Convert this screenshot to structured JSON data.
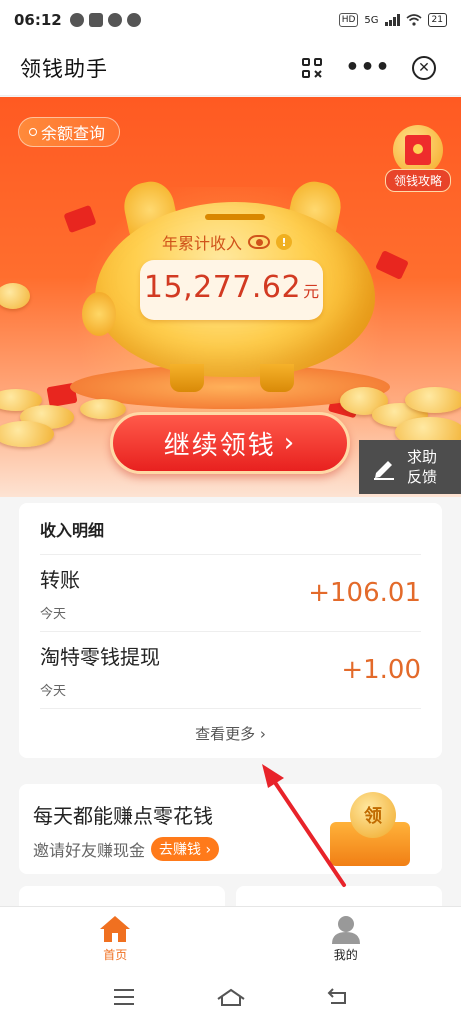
{
  "status_bar": {
    "time": "06:12",
    "hd_label": "HD",
    "network_label": "5G",
    "battery": "21"
  },
  "title_bar": {
    "title": "领钱助手"
  },
  "hero": {
    "balance_query_label": "余额查询",
    "strategy_label": "领钱攻略",
    "year_income_label": "年累计收入",
    "year_income_amount": "15,277.62",
    "currency_unit": "元",
    "continue_button": "继续领钱",
    "continue_chevron": "›"
  },
  "help": {
    "label_line1": "求助",
    "label_line2": "反馈"
  },
  "income": {
    "title": "收入明细",
    "rows": [
      {
        "name": "转账",
        "date": "今天",
        "amount": "+106.01"
      },
      {
        "name": "淘特零钱提现",
        "date": "今天",
        "amount": "+1.00"
      }
    ],
    "more_link": "查看更多",
    "more_chevron": "›"
  },
  "earn": {
    "headline": "每天都能赚点零花钱",
    "sub_text": "邀请好友赚现金",
    "go_button": "去赚钱",
    "go_chevron": "›",
    "coin_char": "领"
  },
  "tabs": [
    {
      "label": "首页",
      "icon": "home-icon",
      "active": true
    },
    {
      "label": "我的",
      "icon": "profile-icon",
      "active": false
    }
  ],
  "colors": {
    "accent": "#f07020",
    "hero_red": "#ff5a22",
    "amount_orange": "#e36a2a",
    "button_red": "#e8211f",
    "annotation_arrow": "#e8232a"
  }
}
